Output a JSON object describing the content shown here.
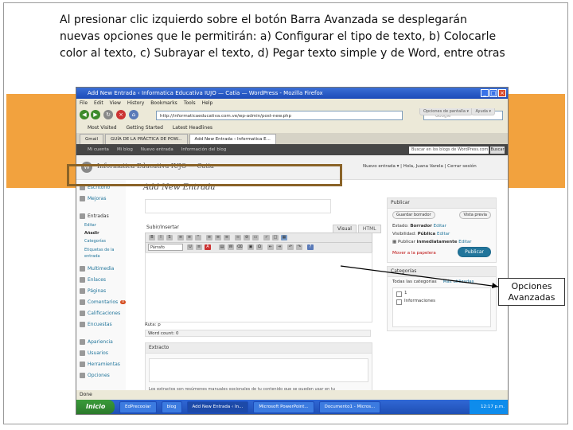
{
  "caption": "Al presionar clic izquierdo sobre el botón Barra Avanzada  se desplegarán nuevas opciones que le permitirán: a) Configurar el tipo de texto, b) Colocarle color al texto, c) Subrayar el texto, d) Pegar texto simple y de Word, entre otras",
  "callout": {
    "line1": "Opciones",
    "line2": "Avanzadas"
  },
  "browser": {
    "title": "Add New Entrada ‹ Informatica Educativa IUJO — Catia — WordPress - Mozilla Firefox",
    "menu": [
      "File",
      "Edit",
      "View",
      "History",
      "Bookmarks",
      "Tools",
      "Help"
    ],
    "url": "http://informaticaeducativa.com.ve/wp-admin/post-new.php",
    "search_placeholder": "Google",
    "bookmarks": [
      "Most Visited",
      "Getting Started",
      "Latest Headlines"
    ],
    "tabs": [
      "Gmail",
      "GUÍA DE LA PRÁCTICA DE POW...",
      "Add New Entrada ‹ Informatica E..."
    ],
    "status": "Done"
  },
  "wp": {
    "adminbar": [
      "Mi cuenta",
      "Mi blog",
      "Nuevo entrada",
      "Información del blog"
    ],
    "adminsearch_placeholder": "Buscar en los blogs de WordPress.com",
    "adminsearch_button": "Buscar",
    "site_title": "Informatica Educativa IUJO — Catia",
    "howdy": "Nuevo entrada  ▾  |  Hola, Juana Varela  |  Cerrar sesión",
    "screen_options": "Opciones de pantalla ▾",
    "help": "Ayuda ▾",
    "sidebar": [
      "Escritorio",
      "Mejoras",
      "Entradas",
      "Editar",
      "Añadir",
      "Categorías",
      "Etiquetas de la entrada",
      "Multimedia",
      "Enlaces",
      "Páginas",
      "Comentarios",
      "Calificaciones",
      "Encuestas",
      "Apariencia",
      "Usuarios",
      "Herramientas",
      "Opciones"
    ],
    "comments_badge": "0",
    "page_title": "Add New Entrada",
    "upload_insert": "Subir/Insertar",
    "editor_tabs": [
      "Visual",
      "HTML"
    ],
    "format_select": "Párrafo",
    "path": "Ruta: p",
    "word_count": "Word count: 0",
    "excerpt_title": "Extracto",
    "excerpt_text": "Los extractos son resúmenes manuales opcionales de tu contenido que se pueden usar en tu",
    "publish": {
      "title": "Publicar",
      "save_draft": "Guardar borrador",
      "preview": "Vista previa",
      "status_label": "Estado:",
      "status_value": "Borrador",
      "status_edit": "Editar",
      "visibility_label": "Visibilidad:",
      "visibility_value": "Pública",
      "visibility_edit": "Editar",
      "publish_label": "Publicar",
      "publish_value": "inmediatamente",
      "publish_edit": "Editar",
      "trash": "Mover a la papelera",
      "publish_button": "Publicar"
    },
    "categories": {
      "title": "Categorías",
      "tab_all": "Todas las categorías",
      "tab_popular": "Más utilizadas",
      "items": [
        "1",
        "Informaciones"
      ]
    }
  },
  "taskbar": {
    "start": "Inicio",
    "tasks": [
      "EdPrecoolar",
      "blog",
      "Add New Entrada ‹ In...",
      "Microsoft PowerPoint...",
      "Documento1 - Micros..."
    ],
    "clock": "12:17 p.m."
  }
}
